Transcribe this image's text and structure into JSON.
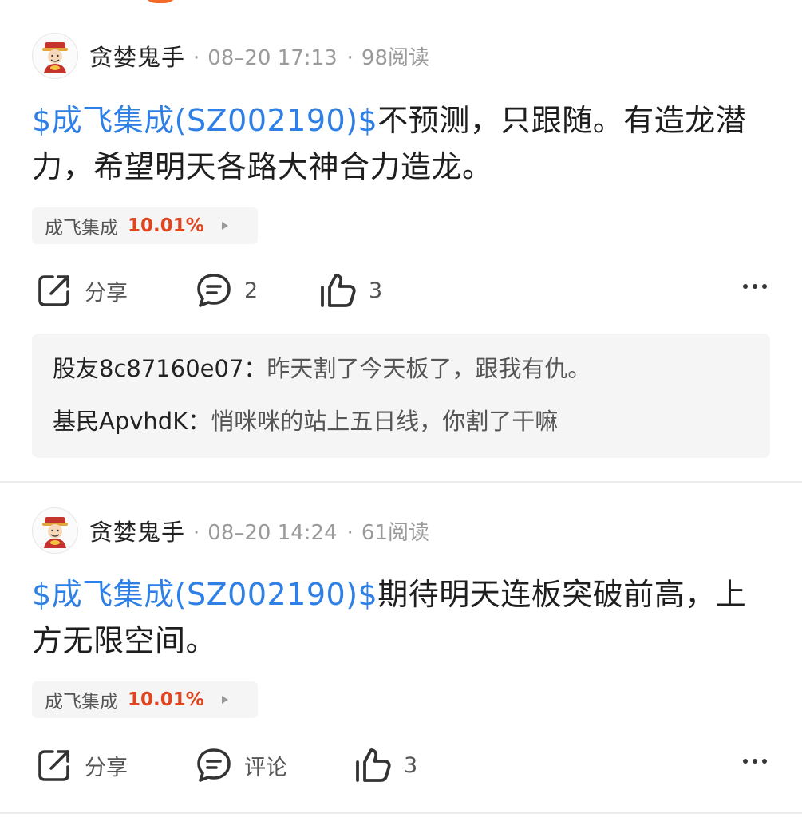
{
  "colors": {
    "link": "#2f80e6",
    "rise": "#e0451f",
    "muted": "#9a9a9a",
    "reply_bg": "#f5f5f5"
  },
  "posts": [
    {
      "author": "贪婪鬼手",
      "date": "08–20 17:13",
      "reads": "98阅读",
      "stock_link": "$成飞集成(SZ002190)$",
      "text": "不预测，只跟随。有造龙潜力，希望明天各路大神合力造龙。",
      "tag_name": "成飞集成",
      "tag_pct": "10.01%",
      "share_label": "分享",
      "comment_label": "2",
      "like_count": "3",
      "replies": [
        {
          "user": "股友8c87160e07：",
          "text": "昨天割了今天板了，跟我有仇。"
        },
        {
          "user": "基民ApvhdK：",
          "text": "悄咪咪的站上五日线，你割了干嘛"
        }
      ]
    },
    {
      "author": "贪婪鬼手",
      "date": "08–20 14:24",
      "reads": "61阅读",
      "stock_link": "$成飞集成(SZ002190)$",
      "text": "期待明天连板突破前高，上方无限空间。",
      "tag_name": "成飞集成",
      "tag_pct": "10.01%",
      "share_label": "分享",
      "comment_label": "评论",
      "like_count": "3"
    }
  ],
  "icons": {
    "avatar": "caishen-avatar",
    "share": "share-icon",
    "comment": "comment-icon",
    "like": "thumbs-up-icon",
    "more": "more-icon"
  }
}
